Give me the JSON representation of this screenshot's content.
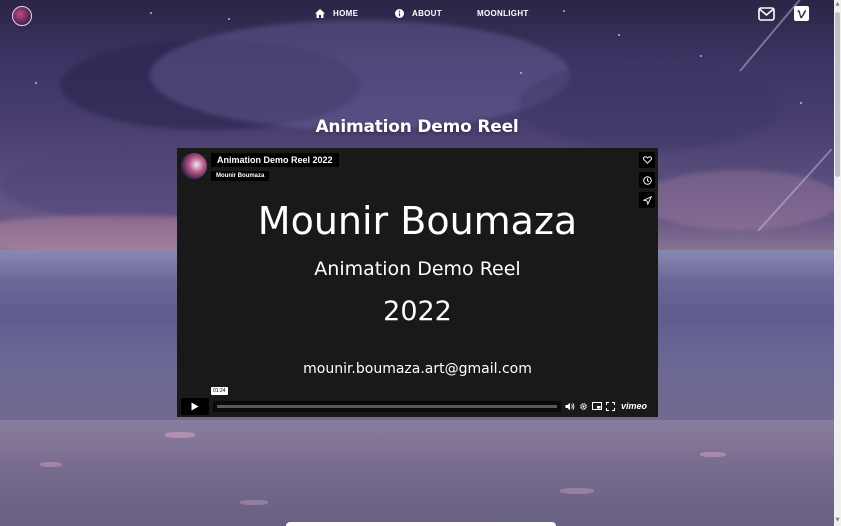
{
  "nav": {
    "home_label": "HOME",
    "about_label": "ABOUT",
    "moonlight_label": "MOONLIGHT"
  },
  "page": {
    "section_title": "Animation Demo Reel"
  },
  "video": {
    "title": "Animation Demo Reel 2022",
    "author": "Mounir Boumaza",
    "slate_name": "Mounir Boumaza",
    "slate_subtitle": "Animation Demo Reel",
    "slate_year": "2022",
    "slate_email": "mounir.boumaza.art@gmail.com",
    "current_time": "01:24",
    "progress": 0,
    "brand": "vimeo",
    "accent_color": "#00adef"
  },
  "icons": {
    "nav_home": "home-icon",
    "nav_about": "info-icon",
    "mail": "mail-icon",
    "vimeo": "vimeo-icon",
    "like": "heart-icon",
    "watch_later": "clock-icon",
    "share": "share-icon",
    "play": "play-icon",
    "volume": "volume-icon",
    "settings": "gear-icon",
    "pip": "picture-in-picture-icon",
    "fullscreen": "fullscreen-icon"
  }
}
